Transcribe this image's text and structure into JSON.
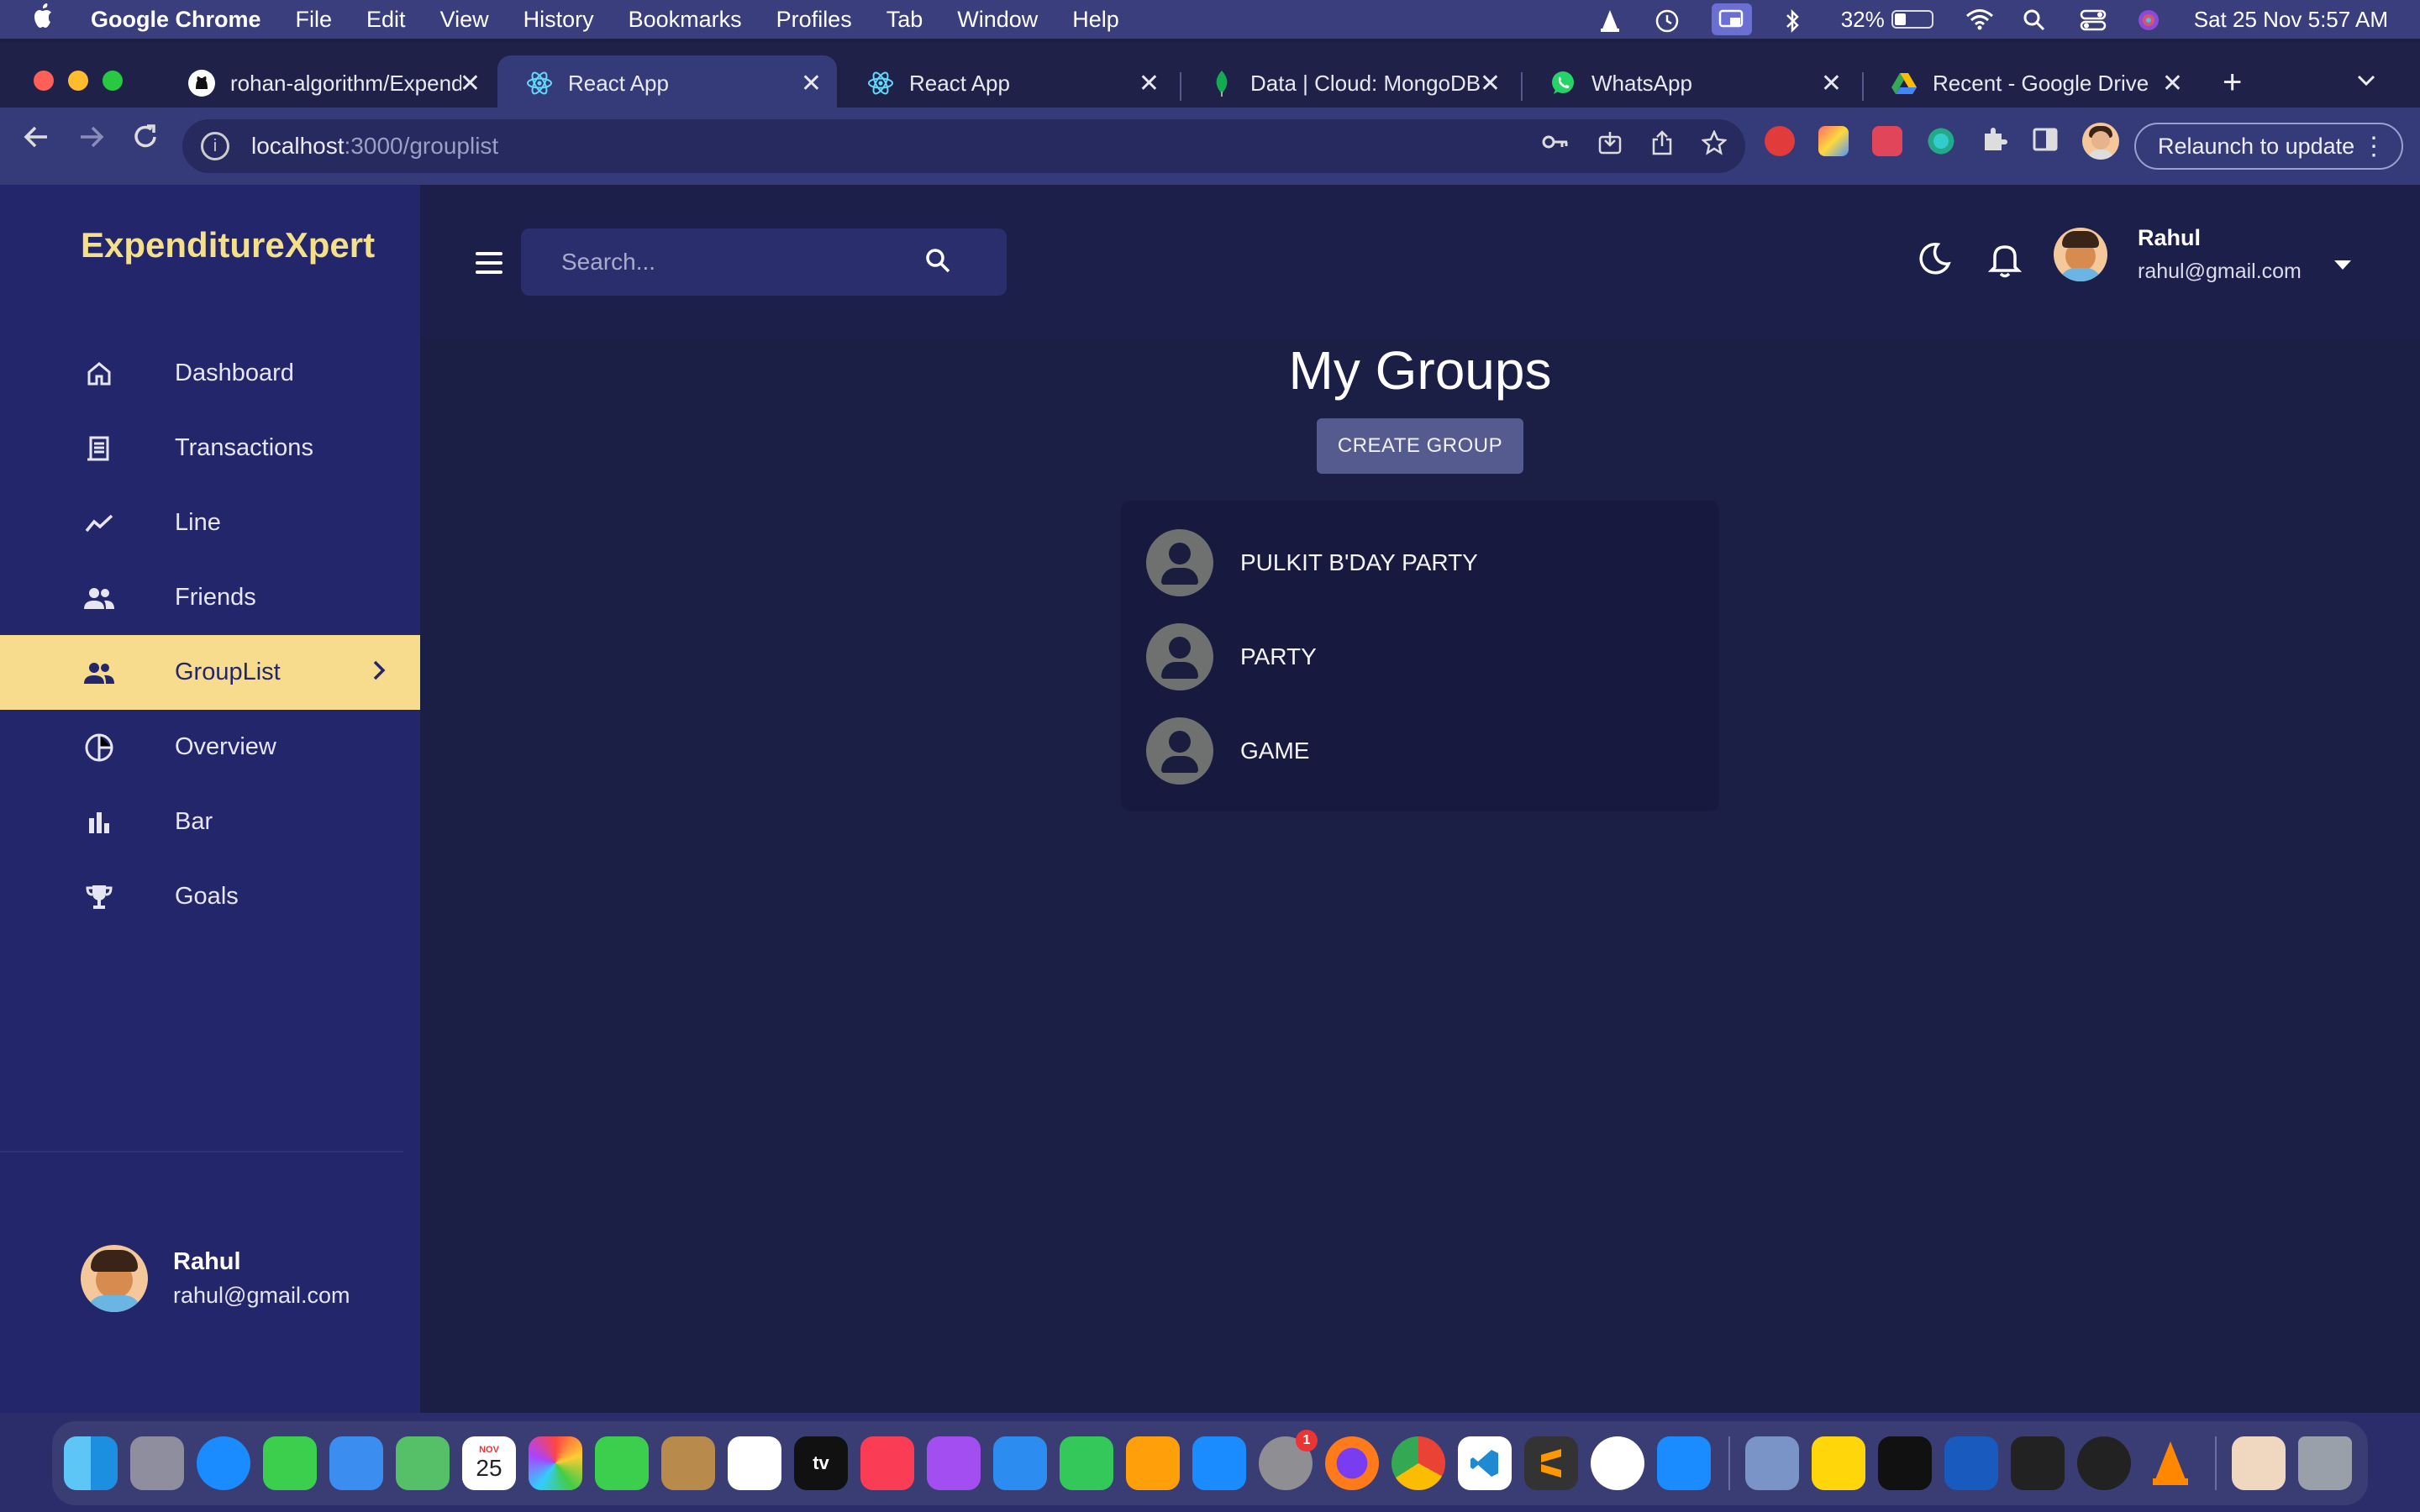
{
  "menubar": {
    "app_name": "Google Chrome",
    "items": [
      "File",
      "Edit",
      "View",
      "History",
      "Bookmarks",
      "Profiles",
      "Tab",
      "Window",
      "Help"
    ],
    "battery": "32%",
    "battery_level": 0.32,
    "datetime": "Sat 25 Nov  5:57 AM"
  },
  "browser": {
    "tabs": [
      {
        "title": "rohan-algorithm/Expenditu",
        "icon": "github-icon"
      },
      {
        "title": "React App",
        "icon": "react-icon",
        "active": true
      },
      {
        "title": "React App",
        "icon": "react-icon"
      },
      {
        "title": "Data | Cloud: MongoDB Cloud",
        "icon": "mongodb-icon"
      },
      {
        "title": "WhatsApp",
        "icon": "whatsapp-icon"
      },
      {
        "title": "Recent - Google Drive",
        "icon": "google-drive-icon"
      }
    ],
    "close_glyph": "✕",
    "new_tab_glyph": "+",
    "url_host": "localhost",
    "url_path": ":3000/grouplist",
    "relaunch_label": "Relaunch to update"
  },
  "app": {
    "brand": "ExpenditureXpert",
    "nav": [
      {
        "label": "Dashboard",
        "icon": "home-icon"
      },
      {
        "label": "Transactions",
        "icon": "receipt-icon"
      },
      {
        "label": "Line",
        "icon": "line-chart-icon"
      },
      {
        "label": "Friends",
        "icon": "people-icon"
      },
      {
        "label": "GroupList",
        "icon": "people-icon",
        "active": true
      },
      {
        "label": "Overview",
        "icon": "pie-chart-icon"
      },
      {
        "label": "Bar",
        "icon": "bar-chart-icon"
      },
      {
        "label": "Goals",
        "icon": "trophy-icon"
      }
    ],
    "user": {
      "name": "Rahul",
      "email": "rahul@gmail.com"
    },
    "search_placeholder": "Search...",
    "page_title": "My Groups",
    "create_button": "CREATE GROUP",
    "groups": [
      "PULKIT B'DAY PARTY",
      "PARTY",
      "GAME"
    ]
  },
  "dock": {
    "calendar_month": "NOV",
    "calendar_day": "25",
    "appletv_label": "tv",
    "settings_badge": "1"
  },
  "colors": {
    "sidebar_bg": "#23266a",
    "main_bg": "#1b1e45",
    "accent": "#f8dc8e",
    "brand": "#f5e08a"
  }
}
